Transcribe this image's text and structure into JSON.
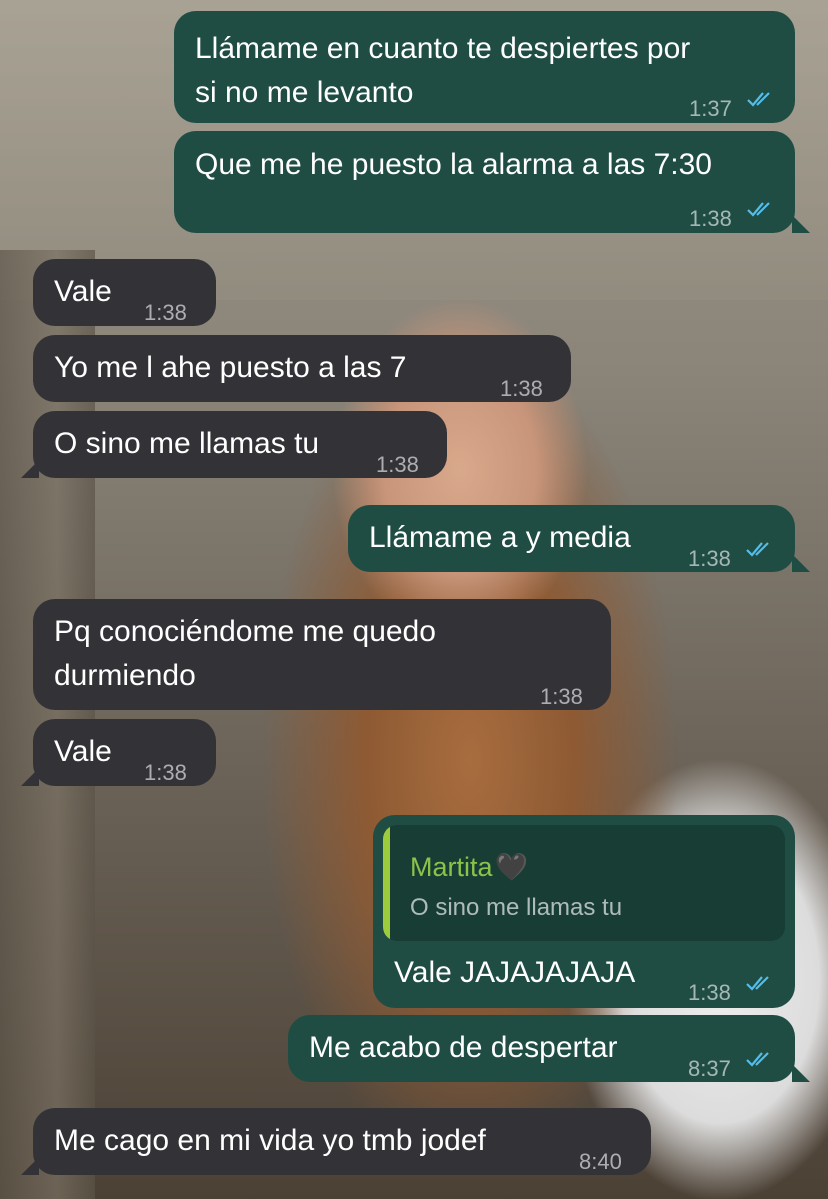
{
  "messages": [
    {
      "id": "m1",
      "direction": "out",
      "lines": [
        "Llámame en cuanto te despiertes por",
        "si no me levanto"
      ],
      "time": "1:37",
      "read": true
    },
    {
      "id": "m2",
      "direction": "out",
      "lines": [
        "Que me he puesto la alarma a las 7:30"
      ],
      "time": "1:38",
      "read": true
    },
    {
      "id": "m3",
      "direction": "in",
      "lines": [
        "Vale"
      ],
      "time": "1:38"
    },
    {
      "id": "m4",
      "direction": "in",
      "lines": [
        "Yo me l ahe puesto a las 7"
      ],
      "time": "1:38"
    },
    {
      "id": "m5",
      "direction": "in",
      "lines": [
        "O sino me llamas tu"
      ],
      "time": "1:38"
    },
    {
      "id": "m6",
      "direction": "out",
      "lines": [
        "Llámame a y media"
      ],
      "time": "1:38",
      "read": true
    },
    {
      "id": "m7",
      "direction": "in",
      "lines": [
        "Pq conociéndome me quedo",
        "durmiendo"
      ],
      "time": "1:38"
    },
    {
      "id": "m8",
      "direction": "in",
      "lines": [
        "Vale"
      ],
      "time": "1:38"
    },
    {
      "id": "m9",
      "direction": "out",
      "reply": {
        "author": "Martita",
        "author_icon": "black-heart",
        "text": "O sino me llamas tu"
      },
      "lines": [
        "Vale JAJAJAJAJA"
      ],
      "time": "1:38",
      "read": true
    },
    {
      "id": "m10",
      "direction": "out",
      "lines": [
        "Me acabo de despertar"
      ],
      "time": "8:37",
      "read": true
    },
    {
      "id": "m11",
      "direction": "in",
      "lines": [
        "Me cago en mi vida yo tmb jodef"
      ],
      "time": "8:40"
    }
  ],
  "colors": {
    "outgoing_bubble": "#1f4d44",
    "incoming_bubble": "#333337",
    "read_ticks": "#53bdeb",
    "quote_accent": "#9ccb3c"
  }
}
